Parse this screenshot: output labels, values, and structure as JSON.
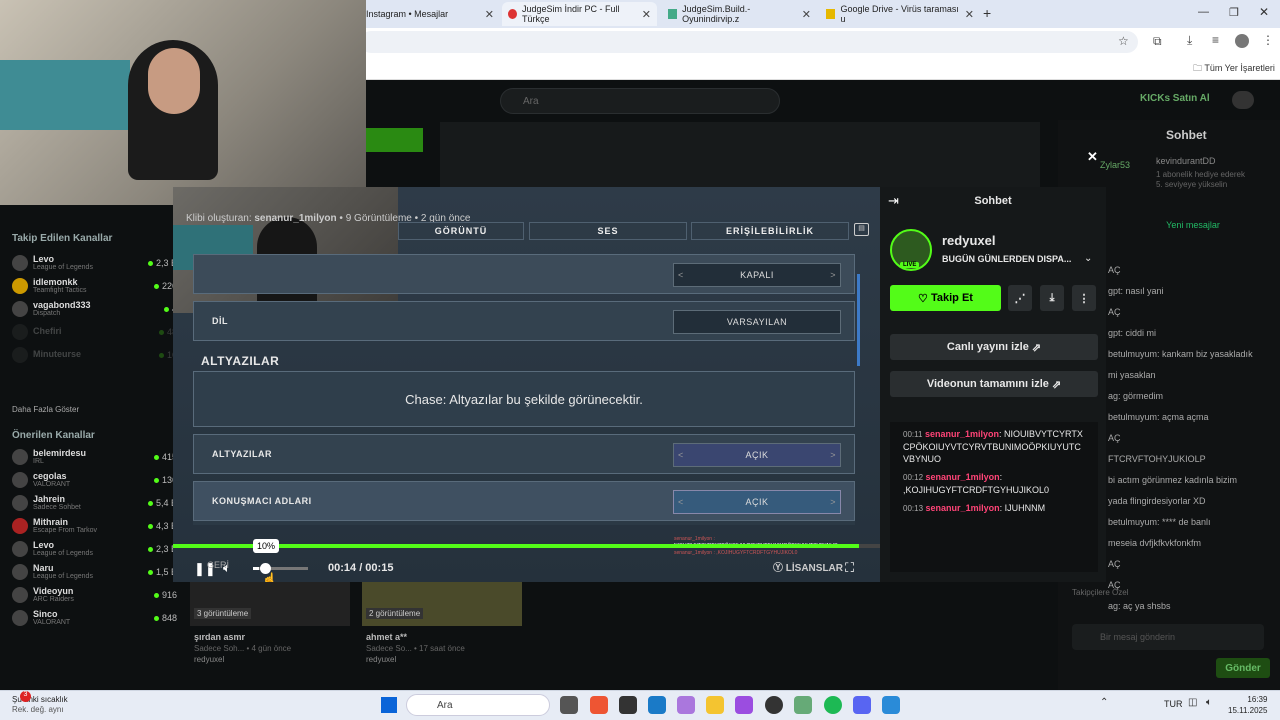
{
  "browser": {
    "tabs": [
      {
        "label": "Instagram • Mesajlar"
      },
      {
        "label": "JudgeSim İndir PC - Full Türkçe"
      },
      {
        "label": "JudgeSim.Build.-Oyunindirvip.z"
      },
      {
        "label": "Google Drive - Virüs taraması u"
      }
    ],
    "new_tab": "+",
    "bookmarks_all": "Tüm Yer İşaretleri"
  },
  "site": {
    "search_placeholder": "Ara",
    "kicks_button": "KICKs Satın Al"
  },
  "sidebar": {
    "followed_title": "Takip Edilen Kanallar",
    "followed": [
      {
        "name": "Levo",
        "game": "League of Legends",
        "viewers": "2,3 B"
      },
      {
        "name": "idlemonkk",
        "game": "Teamfight Tactics",
        "viewers": "226"
      },
      {
        "name": "vagabond333",
        "game": "Dispatch",
        "viewers": "4"
      },
      {
        "name": "Chefiri",
        "game": "",
        "viewers": "48"
      },
      {
        "name": "Minuteurse",
        "game": "",
        "viewers": "16"
      }
    ],
    "show_more": "Daha Fazla Göster",
    "recommended_title": "Önerilen Kanallar",
    "recommended": [
      {
        "name": "belemirdesu",
        "game": "IRL",
        "viewers": "415"
      },
      {
        "name": "cegolas",
        "game": "VALORANT",
        "viewers": "136"
      },
      {
        "name": "Jahrein",
        "game": "Sadece Sohbet",
        "viewers": "5,4 B"
      },
      {
        "name": "Mithrain",
        "game": "Escape From Tarkov",
        "viewers": "4,3 B"
      },
      {
        "name": "Levo",
        "game": "League of Legends",
        "viewers": "2,3 B"
      },
      {
        "name": "Naru",
        "game": "League of Legends",
        "viewers": "1,5 B"
      },
      {
        "name": "Videoyun",
        "game": "ARC Raiders",
        "viewers": "916"
      },
      {
        "name": "Sinco",
        "game": "VALORANT",
        "viewers": "848"
      }
    ]
  },
  "clip": {
    "creator_label": "Klibi oluşturan:",
    "creator": "senanur_1milyon",
    "meta": "• 9 Görüntüleme • 2 gün önce"
  },
  "settings": {
    "tabs": [
      "GÖRÜNTÜ",
      "SES",
      "ERİŞİLEBİLİRLİK"
    ],
    "rows": [
      {
        "label": "",
        "value": "KAPALI"
      },
      {
        "label": "DİL",
        "value": "VARSAYILAN"
      }
    ],
    "subtitles_title": "ALTYAZILAR",
    "preview_text": "Chase: Altyazılar bu şekilde görünecektir.",
    "rows2": [
      {
        "label": "ALTYAZILAR",
        "value": "AÇIK"
      },
      {
        "label": "KONUŞMACI ADLARI",
        "value": "AÇIK"
      }
    ],
    "back_label": "GERİ",
    "license_label": "LİSANSLAR",
    "overlay_line1": "senanur_1milyon :",
    "overlay_line2": "NIOUIBVYTCYRTXCPÖKOIUYVTCYRVTBUNIMOÖPKIUYUTCVBYNUO",
    "overlay_line3": "senanur_1milyon : ,KOJIHUGYFTCRDFTGYHUJIKOL0"
  },
  "player": {
    "volume_tooltip": "10%",
    "time": "00:14 / 00:15",
    "progress": 0.97,
    "volume": 0.1
  },
  "chat_panel": {
    "title": "Sohbet",
    "streamer": "redyuxel",
    "live_badge": "LIVE",
    "stream_title": "BUGÜN GÜNLERDEN DISPA...",
    "follow_button": "Takip Et",
    "watch_live": "Canlı yayını izle",
    "watch_full": "Videonun tamamını izle",
    "messages": [
      {
        "time": "00:11",
        "user": "senanur_1milyon",
        "text": "NIOUIBVYTCYRTXCPÖKOIUYVTCYRVTBUNIMOÖPKIUYUTCVBYNUO"
      },
      {
        "time": "00:12",
        "user": "senanur_1milyon",
        "text": ",KOJIHUGYFTCRDFTGYHUJIKOL0"
      },
      {
        "time": "00:13",
        "user": "senanur_1milyon",
        "text": "IJUHNNM"
      }
    ]
  },
  "right_chat": {
    "title": "Sohbet",
    "pinned_user": "kevindurantDD",
    "pinned_text": "1 abonelik hediye ederek",
    "pinned_text2": "5. seviyeye yükselin",
    "side_user": "Zylar53",
    "new_messages": "Yeni mesajlar",
    "lines": [
      "AÇ",
      "gpt: nasıl yani",
      "AÇ",
      "gpt: ciddi mi",
      "betulmuyum: kankam biz yasakladık",
      "mi yasaklan",
      "ag: görmedim",
      "betulmuyum: açma açma",
      "AÇ",
      "FTCRVFTOHYJUKIOLP",
      "bi actım görünmez kadınla bizim",
      "yada flingirdesiyorlar XD",
      "betulmuyum: **** de banlı",
      "meseia dvfjkfkvkfonkfm",
      "AÇ",
      "AÇ",
      "ag: aç ya shsbs"
    ],
    "top_supporters": "Takipçilere Özel",
    "input_placeholder": "Bir mesaj gönderin",
    "send_button": "Gönder"
  },
  "below": {
    "cards": [
      {
        "views": "3 görüntüleme",
        "title": "şırdan asmr",
        "sub": "Sadece Soh... • 4 gün önce",
        "user": "redyuxel"
      },
      {
        "views": "2 görüntüleme",
        "title": "ahmet a**",
        "sub": "Sadece So... • 17 saat önce",
        "user": "redyuxel"
      }
    ]
  },
  "taskbar": {
    "weather": "Şu anki sıcaklık",
    "weather2": "Rek. değ. aynı",
    "search": "Ara",
    "lang": "TUR",
    "time": "16:39",
    "date": "15.11.2025",
    "badge": "3"
  }
}
